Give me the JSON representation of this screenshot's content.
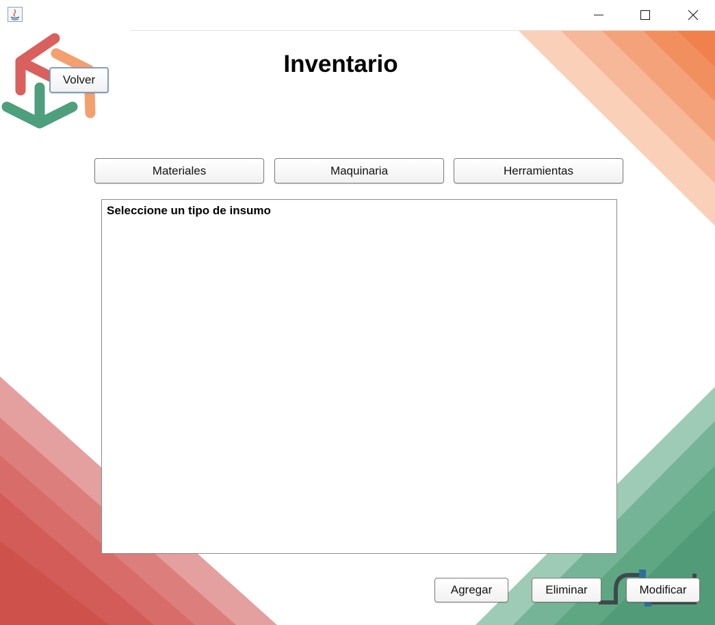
{
  "window": {
    "title": "",
    "controls": {
      "minimize": "minimize-icon",
      "maximize": "maximize-icon",
      "close": "close-icon"
    }
  },
  "header": {
    "title": "Inventario",
    "back_label": "Volver"
  },
  "tabs": [
    {
      "label": "Materiales"
    },
    {
      "label": "Maquinaria"
    },
    {
      "label": "Herramientas"
    }
  ],
  "content": {
    "message": "Seleccione un tipo de insumo"
  },
  "actions": {
    "add_label": "Agregar",
    "delete_label": "Eliminar",
    "modify_label": "Modificar"
  },
  "colors": {
    "accent_orange": "#F0854F",
    "accent_red": "#D2504B",
    "accent_green": "#4E9F7D"
  }
}
